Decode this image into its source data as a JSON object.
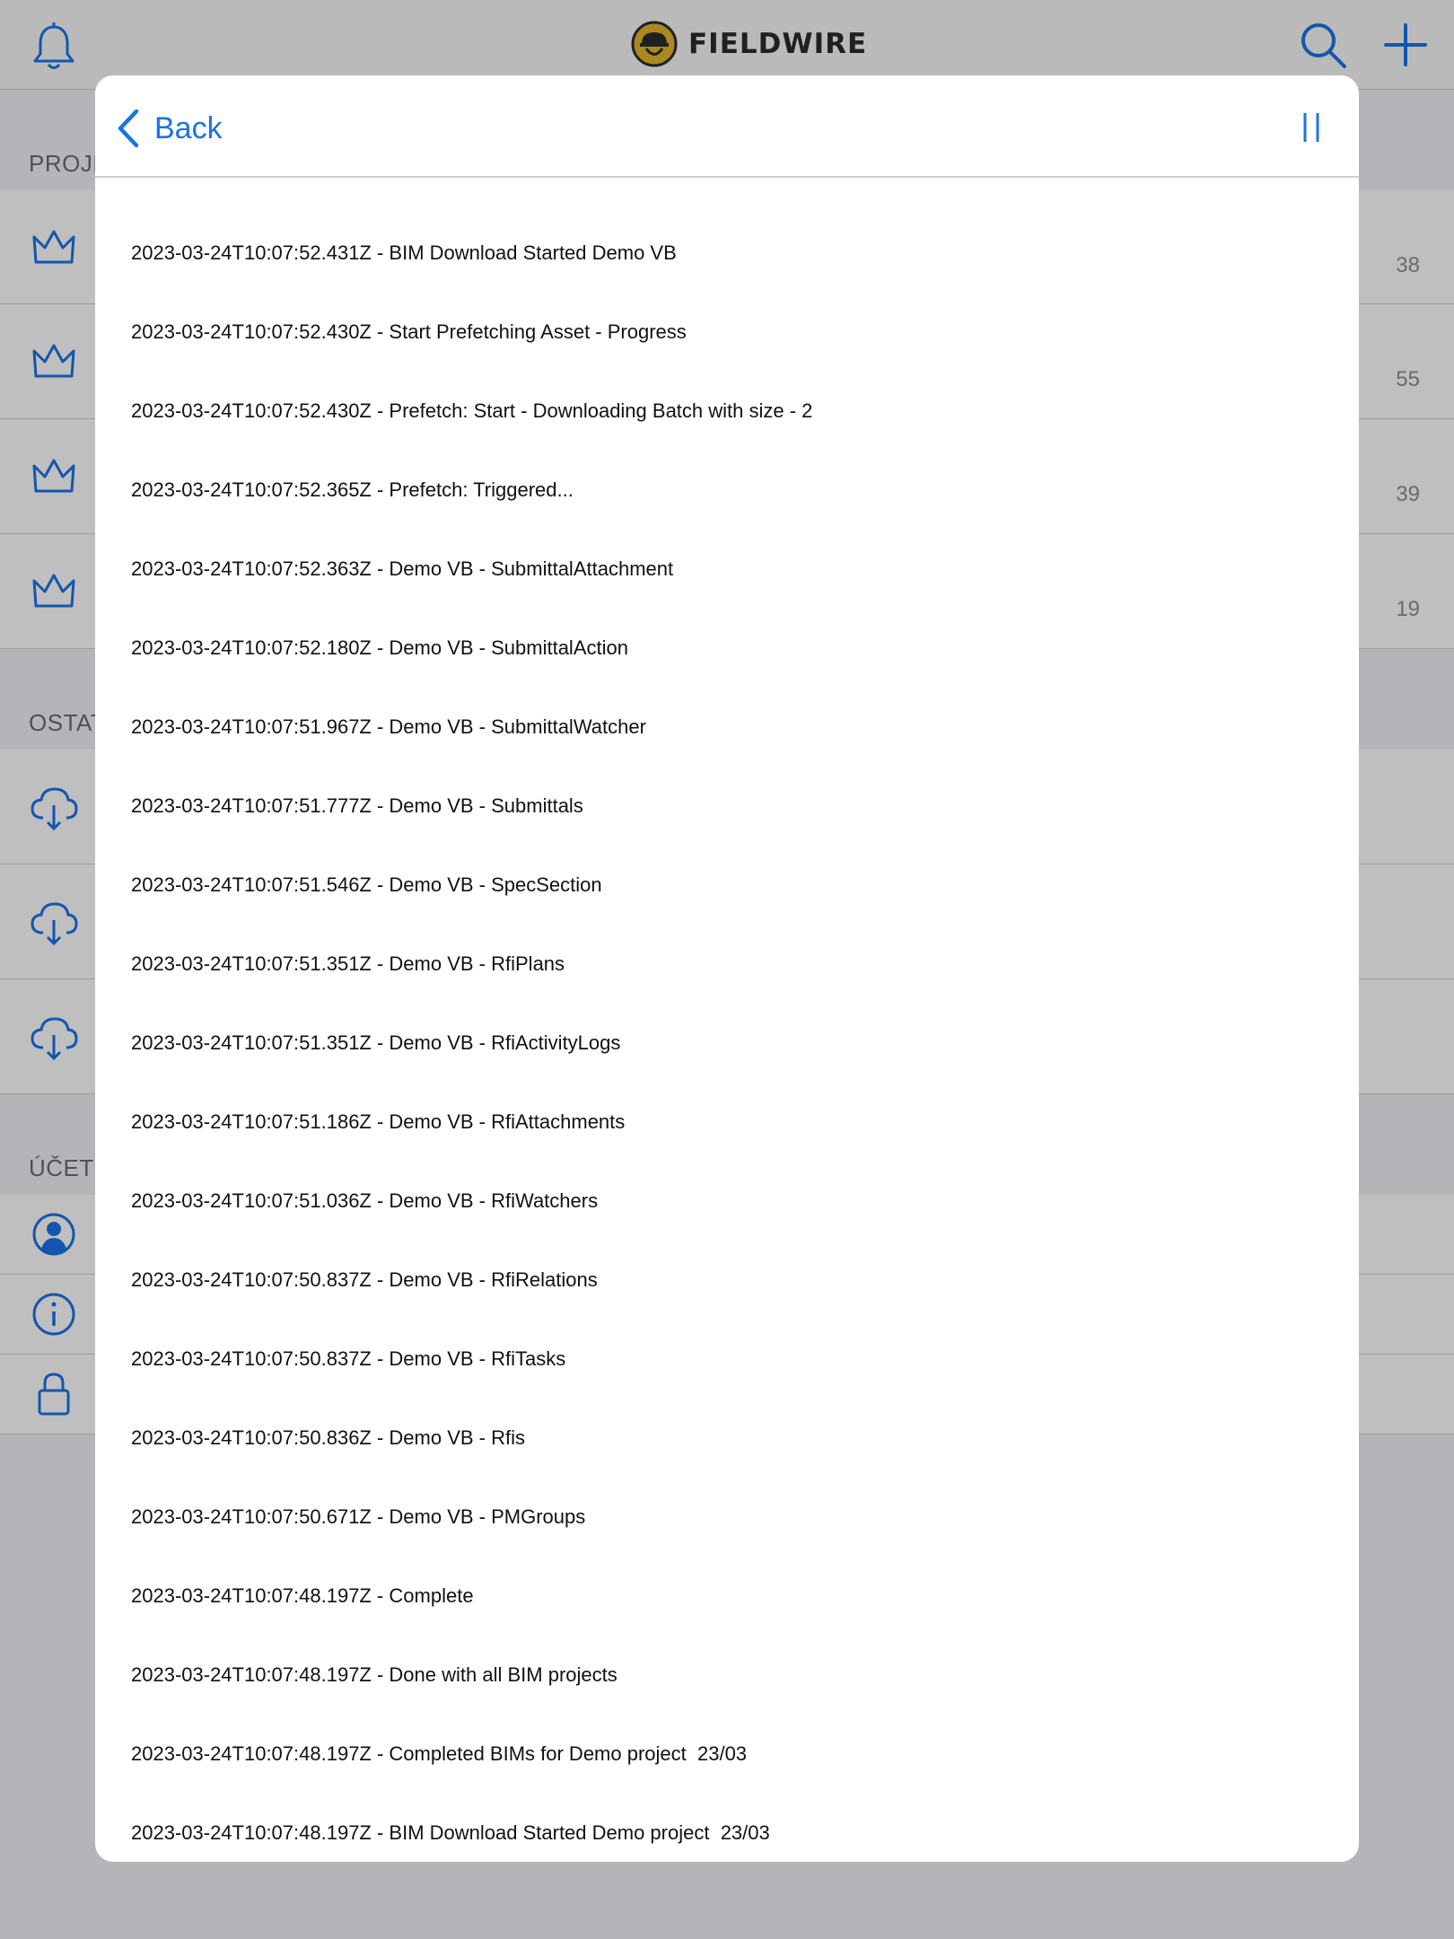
{
  "topbar": {
    "brand": "FIELDWIRE",
    "icons": [
      "bell-icon",
      "search-icon",
      "plus-icon"
    ]
  },
  "sections": [
    {
      "label": "PROJE",
      "icon": "crown-icon",
      "rows": [
        "38",
        "55",
        "39",
        "19"
      ]
    },
    {
      "label": "OSTAT",
      "icon": "cloud-download-icon",
      "rows": [
        "",
        "",
        ""
      ]
    },
    {
      "label": "ÚČET",
      "icons": [
        "account-icon",
        "info-icon",
        "lock-icon"
      ]
    }
  ],
  "modal": {
    "back_label": "Back",
    "logs": [
      "2023-03-24T10:07:52.431Z - BIM Download Started Demo VB",
      "2023-03-24T10:07:52.430Z - Start Prefetching Asset - Progress",
      "2023-03-24T10:07:52.430Z - Prefetch: Start - Downloading Batch with size - 2",
      "2023-03-24T10:07:52.365Z - Prefetch: Triggered...",
      "2023-03-24T10:07:52.363Z - Demo VB - SubmittalAttachment",
      "2023-03-24T10:07:52.180Z - Demo VB - SubmittalAction",
      "2023-03-24T10:07:51.967Z - Demo VB - SubmittalWatcher",
      "2023-03-24T10:07:51.777Z - Demo VB - Submittals",
      "2023-03-24T10:07:51.546Z - Demo VB - SpecSection",
      "2023-03-24T10:07:51.351Z - Demo VB - RfiPlans",
      "2023-03-24T10:07:51.351Z - Demo VB - RfiActivityLogs",
      "2023-03-24T10:07:51.186Z - Demo VB - RfiAttachments",
      "2023-03-24T10:07:51.036Z - Demo VB - RfiWatchers",
      "2023-03-24T10:07:50.837Z - Demo VB - RfiRelations",
      "2023-03-24T10:07:50.837Z - Demo VB - RfiTasks",
      "2023-03-24T10:07:50.836Z - Demo VB - Rfis",
      "2023-03-24T10:07:50.671Z - Demo VB - PMGroups",
      "2023-03-24T10:07:48.197Z - Complete",
      "2023-03-24T10:07:48.197Z - Done with all BIM projects",
      "2023-03-24T10:07:48.197Z - Completed BIMs for Demo project  23/03",
      "2023-03-24T10:07:48.197Z - BIM Download Started Demo project  23/03"
    ]
  },
  "colors": {
    "accent": "#1a73e8",
    "scrim": "rgba(0,0,0,0.25)",
    "logo_yellow": "#e5b72a"
  }
}
